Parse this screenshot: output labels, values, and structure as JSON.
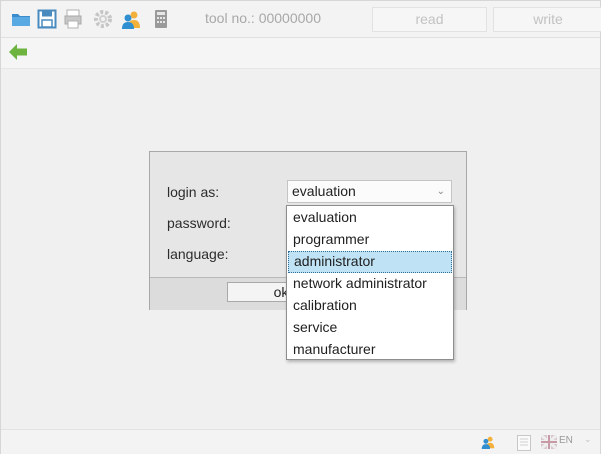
{
  "toolbar": {
    "icons": [
      "open-folder-icon",
      "save-icon",
      "print-icon",
      "settings-gear-icon",
      "user-icon",
      "calculator-icon"
    ],
    "tool_no_label": "tool no.: 00000000",
    "read_label": "read",
    "write_label": "write"
  },
  "nav": {
    "back_icon": "back-arrow-icon"
  },
  "login_dialog": {
    "login_as_label": "login as:",
    "password_label": "password:",
    "language_label": "language:",
    "login_as_value": "evaluation",
    "ok_label": "ok"
  },
  "dropdown": {
    "options": [
      "evaluation",
      "programmer",
      "administrator",
      "network administrator",
      "calibration",
      "service",
      "manufacturer"
    ],
    "selected": "administrator"
  },
  "statusbar": {
    "icons": [
      "user-icon",
      "document-icon",
      "flag-icon"
    ],
    "language": "EN"
  },
  "colors": {
    "selection": "#bfe3f5",
    "accent_blue": "#2f8fd0",
    "back_green": "#6cb33f"
  }
}
